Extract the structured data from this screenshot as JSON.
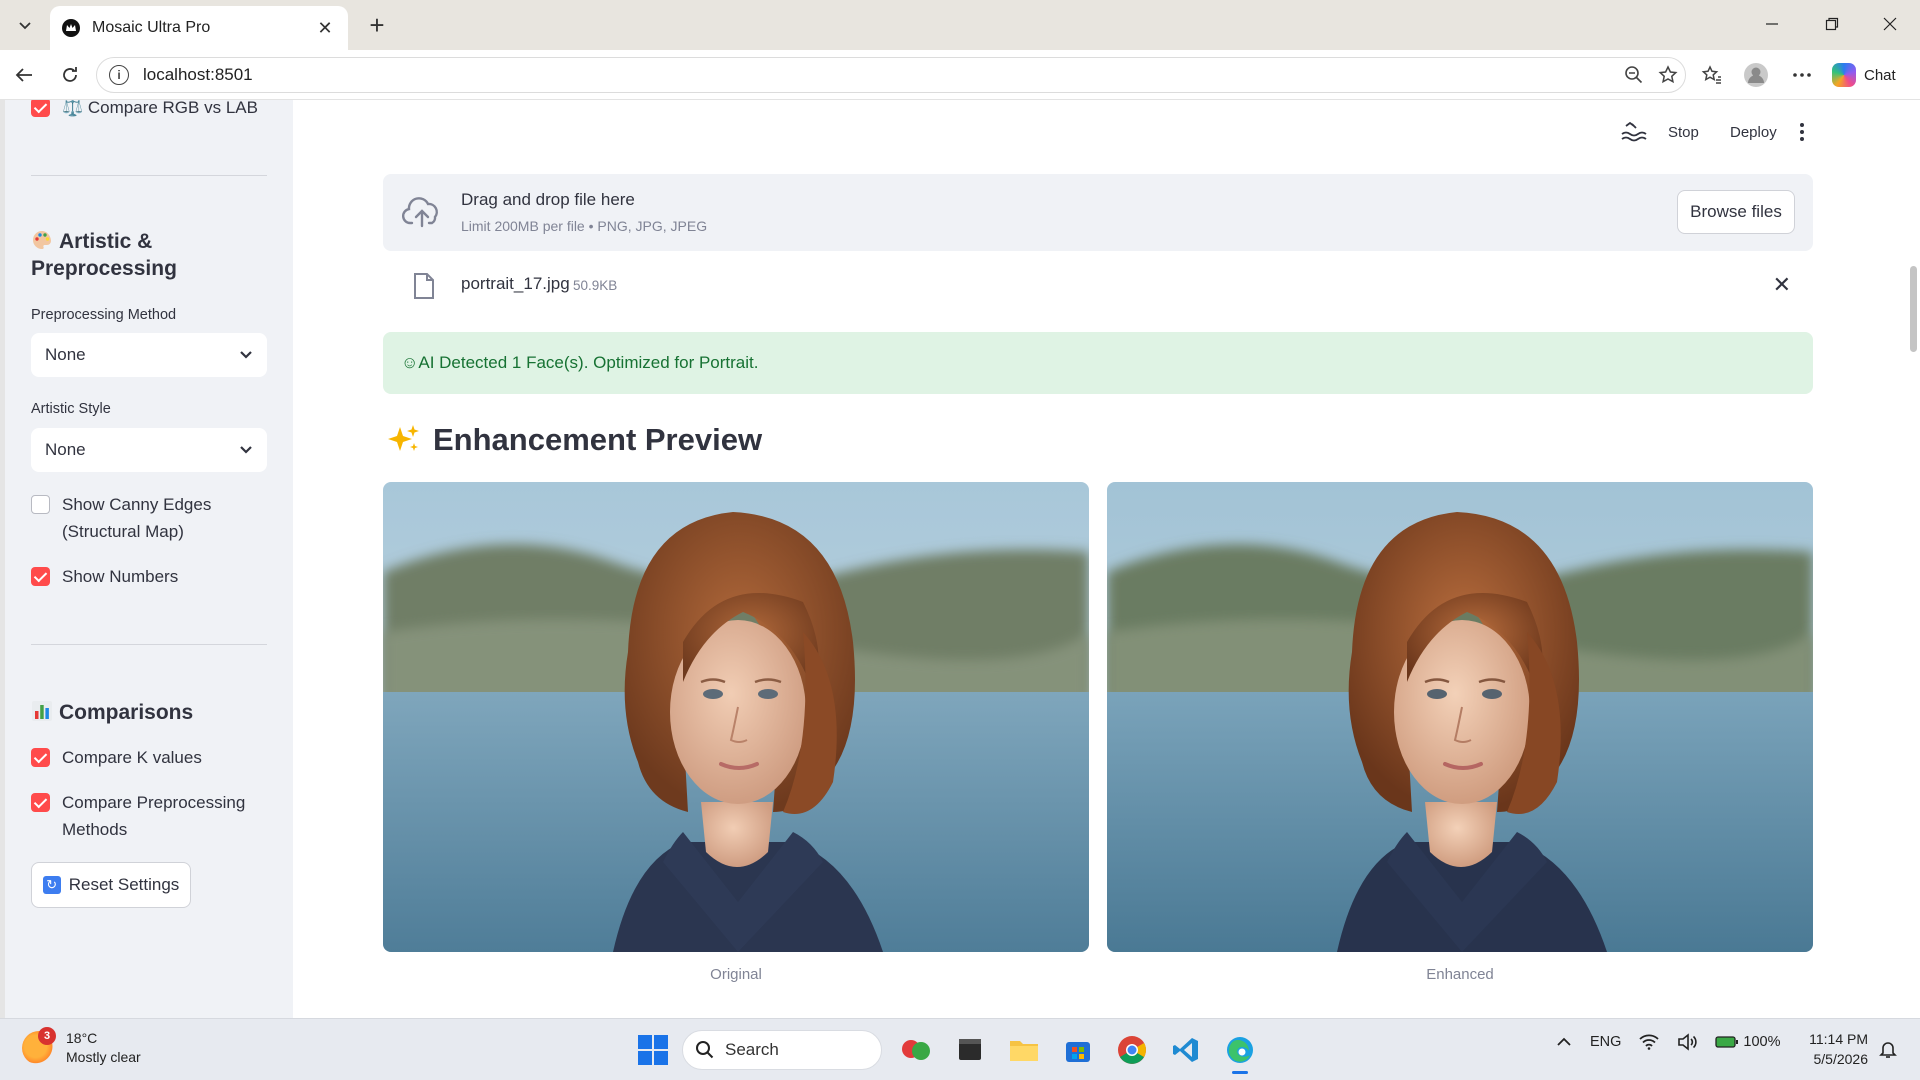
{
  "browser": {
    "tab_title": "Mosaic Ultra Pro",
    "url": "localhost:8501",
    "chat_label": "Chat"
  },
  "header": {
    "stop_label": "Stop",
    "deploy_label": "Deploy"
  },
  "sidebar": {
    "top_checkbox": {
      "label": "⚖️ Compare RGB vs LAB",
      "checked": true
    },
    "artistic_heading": "Artistic & Preprocessing",
    "preprocessing_label": "Preprocessing Method",
    "preprocessing_value": "None",
    "artistic_label": "Artistic Style",
    "artistic_value": "None",
    "canny_checkbox": {
      "label": "Show Canny Edges (Structural Map)",
      "checked": false
    },
    "numbers_checkbox": {
      "label": "Show Numbers",
      "checked": true
    },
    "comparisons_heading": "Comparisons",
    "compare_k_checkbox": {
      "label": "Compare K values",
      "checked": true
    },
    "compare_pre_checkbox": {
      "label": "Compare Preprocessing Methods",
      "checked": true
    },
    "reset_label": "Reset Settings"
  },
  "uploader": {
    "title": "Drag and drop file here",
    "limit": "Limit 200MB per file • PNG, JPG, JPEG",
    "browse_label": "Browse files",
    "file_name": "portrait_17.jpg",
    "file_size": "50.9KB"
  },
  "alert": {
    "text": "☺AI Detected 1 Face(s). Optimized for Portrait."
  },
  "preview": {
    "title": "Enhancement Preview",
    "original_caption": "Original",
    "enhanced_caption": "Enhanced"
  },
  "taskbar": {
    "temperature": "18°C",
    "weather": "Mostly clear",
    "weather_badge": "3",
    "search_placeholder": "Search",
    "language": "ENG",
    "battery": "100%",
    "time": "11:14 PM",
    "date": "5/5/2026"
  },
  "colors": {
    "accent": "#ff4b4b",
    "sidebar_bg": "#f0f2f6",
    "success_bg": "#dff3e4",
    "success_text": "#177233"
  }
}
